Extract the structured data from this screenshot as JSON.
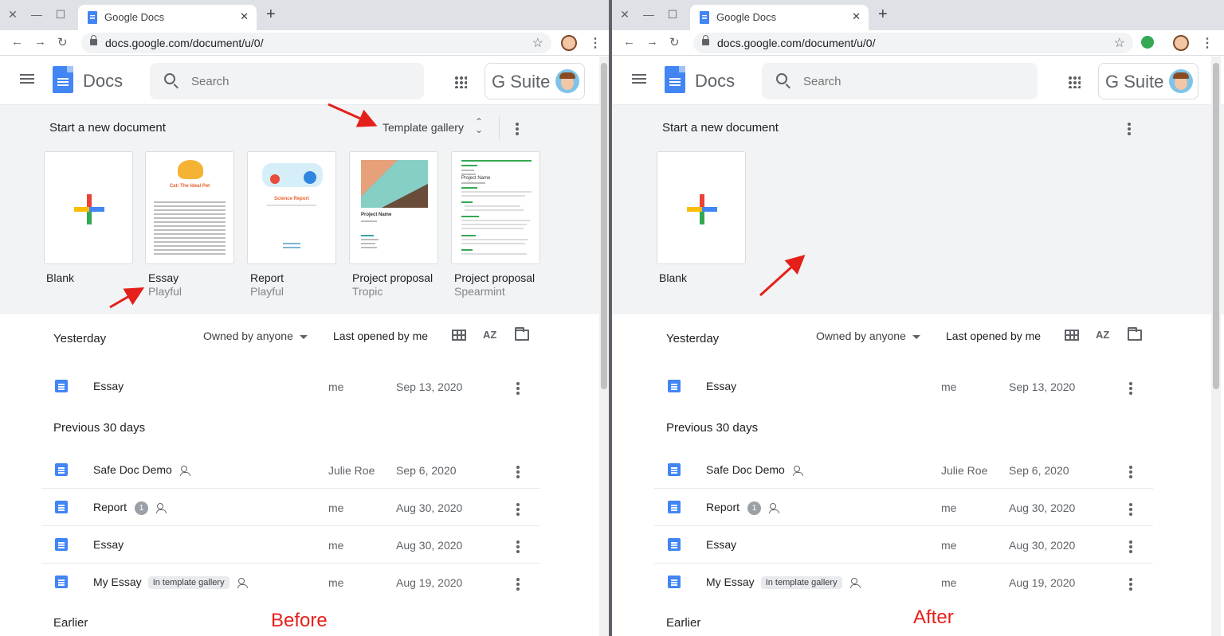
{
  "browser": {
    "tab_title": "Google Docs",
    "url": "docs.google.com/document/u/0/"
  },
  "docs": {
    "app_name": "Docs",
    "search_placeholder": "Search",
    "gsuite_label": "G Suite"
  },
  "templates": {
    "start_label": "Start a new document",
    "gallery_label": "Template gallery",
    "items": [
      {
        "name": "Blank",
        "sub": ""
      },
      {
        "name": "Essay",
        "sub": "Playful"
      },
      {
        "name": "Report",
        "sub": "Playful"
      },
      {
        "name": "Project proposal",
        "sub": "Tropic"
      },
      {
        "name": "Project proposal",
        "sub": "Spearmint"
      }
    ],
    "essay_thumb_title": "Cat: The Ideal Pet",
    "report_thumb_title": "Science Report",
    "proposal_thumb_title": "Project Name"
  },
  "list": {
    "owned_by": "Owned by anyone",
    "sort": "Last opened by me",
    "az_label": "AZ",
    "sections": {
      "yesterday": "Yesterday",
      "previous": "Previous 30 days",
      "earlier": "Earlier"
    },
    "rows": [
      {
        "name": "Essay",
        "owner": "me",
        "date": "Sep 13, 2020"
      },
      {
        "name": "Safe Doc Demo",
        "owner": "Julie Roe",
        "date": "Sep 6, 2020"
      },
      {
        "name": "Report",
        "badge": "1",
        "owner": "me",
        "date": "Aug 30, 2020"
      },
      {
        "name": "Essay",
        "owner": "me",
        "date": "Aug 30, 2020"
      },
      {
        "name": "My Essay",
        "chip": "In template gallery",
        "owner": "me",
        "date": "Aug 19, 2020"
      }
    ]
  },
  "annotations": {
    "before": "Before",
    "after": "After"
  },
  "colors": {
    "annotation_red": "#e5201b",
    "docs_blue": "#4285f4"
  }
}
